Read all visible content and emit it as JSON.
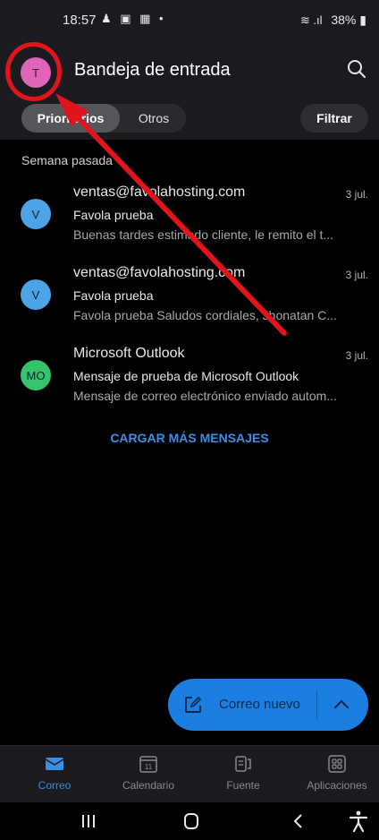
{
  "status_bar": {
    "time": "18:57",
    "indicators": "♟ ▣ ▦ •",
    "signal": "≋ .ıl",
    "battery": "38%"
  },
  "header": {
    "avatar_letter": "T",
    "title": "Bandeja de entrada",
    "tabs": [
      {
        "label": "Prioritarios"
      },
      {
        "label": "Otros"
      }
    ],
    "filter_label": "Filtrar"
  },
  "section": {
    "label": "Semana pasada"
  },
  "messages": [
    {
      "avatar": "V",
      "avatar_color": "#4ca3e6",
      "sender": "ventas@favolahosting.com",
      "date": "3 jul.",
      "subject": "Favola prueba",
      "preview": "Buenas tardes estimado cliente, le remito el t..."
    },
    {
      "avatar": "V",
      "avatar_color": "#4ca3e6",
      "sender": "ventas@favolahosting.com",
      "date": "3 jul.",
      "subject": "Favola prueba",
      "preview": "Favola prueba Saludos cordiales, Jhonatan C..."
    },
    {
      "avatar": "MO",
      "avatar_color": "#35c46b",
      "sender": "Microsoft Outlook",
      "date": "3 jul.",
      "subject": "Mensaje de prueba de Microsoft Outlook",
      "preview": "Mensaje de correo electrónico enviado autom..."
    }
  ],
  "load_more": "CARGAR MÁS MENSAJES",
  "fab": {
    "label": "Correo nuevo"
  },
  "bottom_nav": [
    {
      "label": "Correo",
      "icon": "mail-icon",
      "active": true
    },
    {
      "label": "Calendario",
      "icon": "calendar-icon",
      "day": "11"
    },
    {
      "label": "Fuente",
      "icon": "feed-icon"
    },
    {
      "label": "Aplicaciones",
      "icon": "apps-icon"
    }
  ],
  "colors": {
    "accent": "#1a7fe0",
    "annotation": "#e0141a"
  }
}
